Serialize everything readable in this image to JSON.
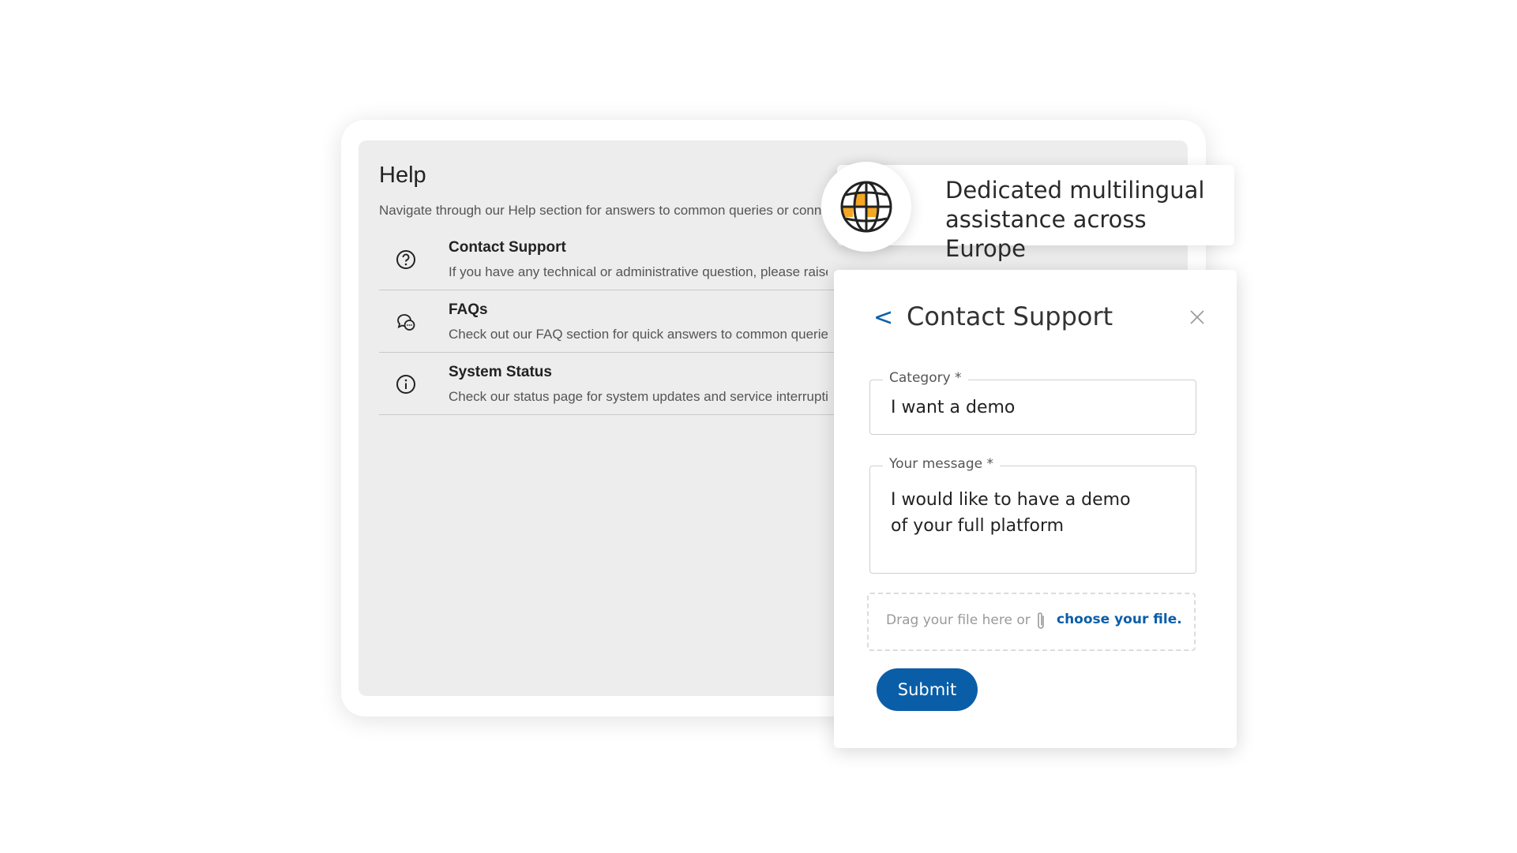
{
  "help": {
    "title": "Help",
    "subtitle": "Navigate through our Help section for answers to common queries or conn",
    "items": [
      {
        "title": "Contact Support",
        "description": "If you have any technical or administrative question, please raise",
        "icon": "question-circle-icon"
      },
      {
        "title": "FAQs",
        "description": "Check out our FAQ section for quick answers to common queries",
        "icon": "chat-bubbles-icon"
      },
      {
        "title": "System Status",
        "description": "Check our status page for system updates and service interruptio",
        "icon": "info-circle-icon"
      }
    ]
  },
  "banner": {
    "text": "Dedicated multilingual assistance across Europe",
    "icon": "globe-icon",
    "accent": "#f5a623"
  },
  "modal": {
    "back_label": "<",
    "title": "Contact Support",
    "close_icon": "close-icon",
    "category": {
      "label": "Category *",
      "value": "I want a demo"
    },
    "message": {
      "label": "Your message *",
      "line1": "I would like to have a demo",
      "line2": "of your full platform"
    },
    "upload": {
      "text": "Drag your file here or",
      "link": "choose your file.",
      "icon": "paperclip-icon"
    },
    "submit_label": "Submit",
    "accent": "#0a5ea8"
  }
}
